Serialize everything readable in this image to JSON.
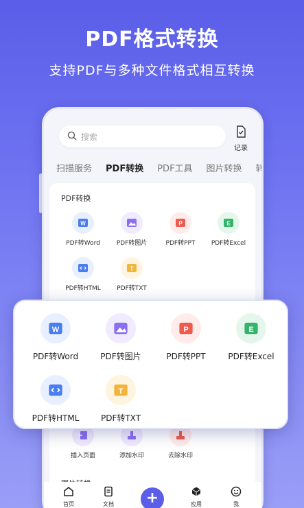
{
  "hero": {
    "title": "PDF格式转换",
    "subtitle": "支持PDF与多种文件格式相互转换"
  },
  "search": {
    "placeholder": "搜索"
  },
  "record": {
    "label": "记录"
  },
  "tabs": [
    {
      "label": "扫描服务"
    },
    {
      "label": "PDF转换"
    },
    {
      "label": "PDF工具"
    },
    {
      "label": "图片转换"
    },
    {
      "label": "转"
    }
  ],
  "section_pdf": {
    "title": "PDF转换",
    "items": [
      {
        "label": "PDF转Word"
      },
      {
        "label": "PDF转图片"
      },
      {
        "label": "PDF转PPT"
      },
      {
        "label": "PDF转Excel"
      },
      {
        "label": "PDF转HTML"
      },
      {
        "label": "PDF转TXT"
      }
    ]
  },
  "popup": {
    "items": [
      {
        "label": "PDF转Word"
      },
      {
        "label": "PDF转图片"
      },
      {
        "label": "PDF转PPT"
      },
      {
        "label": "PDF转Excel"
      },
      {
        "label": "PDF转HTML"
      },
      {
        "label": "PDF转TXT"
      }
    ]
  },
  "tools_row": [
    {
      "label": "插入页面"
    },
    {
      "label": "添加水印"
    },
    {
      "label": "去除水印"
    }
  ],
  "section_image": {
    "title": "图片转换"
  },
  "bottom_nav": [
    {
      "label": "首页"
    },
    {
      "label": "文档"
    },
    {
      "label": "应用"
    },
    {
      "label": "我"
    }
  ],
  "colors": {
    "word": "#4a7df0",
    "image": "#8a6ff2",
    "ppt": "#ef5a4e",
    "excel": "#34b36a",
    "html": "#4a7df0",
    "txt": "#f2b53a",
    "accent": "#5a5ee8"
  }
}
